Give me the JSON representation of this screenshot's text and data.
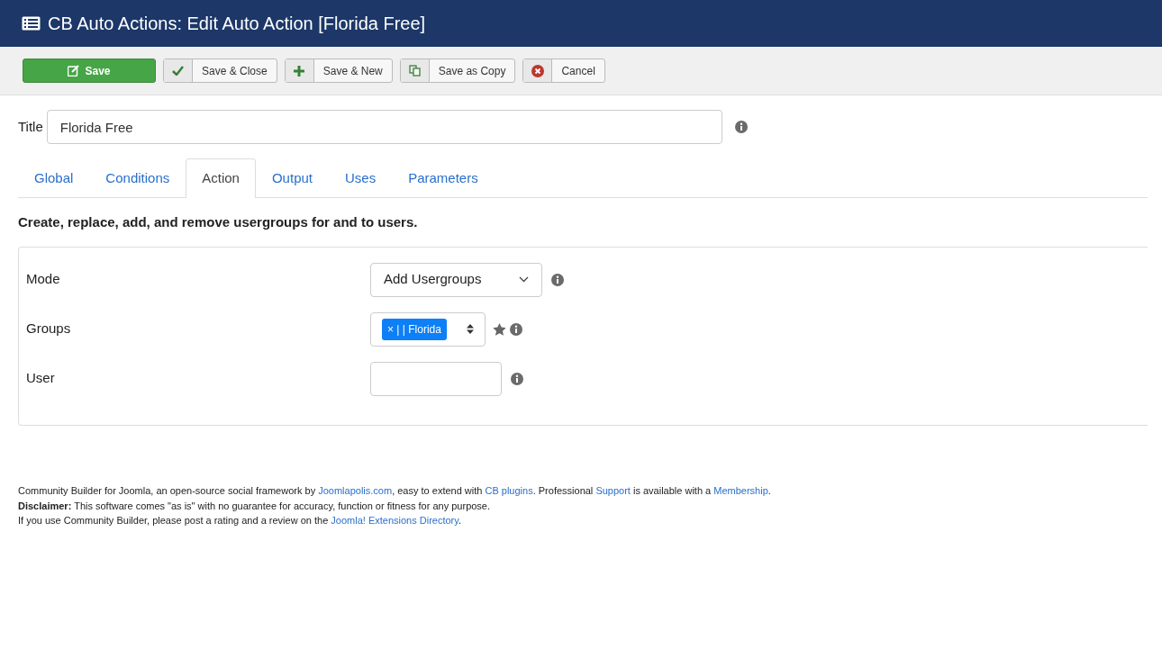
{
  "window": {
    "title": "CB Auto Actions: Edit Auto Action [Florida Free]"
  },
  "toolbar": [
    {
      "label": "Save",
      "kind": "primary"
    },
    {
      "label": "Save & Close",
      "kind": "check"
    },
    {
      "label": "Save & New",
      "kind": "plus"
    },
    {
      "label": "Save as Copy",
      "kind": "copy"
    },
    {
      "label": "Cancel",
      "kind": "cancel"
    }
  ],
  "title_field": {
    "label": "Title",
    "value": "Florida Free"
  },
  "tabs": [
    {
      "label": "Global",
      "selected": false
    },
    {
      "label": "Conditions",
      "selected": false
    },
    {
      "label": "Action",
      "selected": true
    },
    {
      "label": "Output",
      "selected": false
    },
    {
      "label": "Uses",
      "selected": false
    },
    {
      "label": "Parameters",
      "selected": false
    }
  ],
  "description": "Create, replace, add, and remove usergroups for and to users.",
  "fields": [
    {
      "label": "Mode",
      "kind": "select",
      "value": "Add Usergroups"
    },
    {
      "label": "Groups",
      "kind": "tags",
      "tags": [
        "× | | Florida"
      ]
    },
    {
      "label": "User",
      "kind": "text"
    }
  ],
  "footer": [
    [
      {
        "kind": "text",
        "text": "Community Builder for Joomla, an open-source social framework by "
      },
      {
        "kind": "link",
        "text": "Joomlapolis.com"
      },
      {
        "kind": "text",
        "text": ", easy to extend with "
      },
      {
        "kind": "link",
        "text": "CB plugins"
      },
      {
        "kind": "text",
        "text": ". Professional "
      },
      {
        "kind": "link",
        "text": "Support"
      },
      {
        "kind": "text",
        "text": " is available with a "
      },
      {
        "kind": "link",
        "text": "Membership"
      },
      {
        "kind": "text",
        "text": "."
      }
    ],
    [
      {
        "kind": "bold",
        "text": "Disclaimer:"
      },
      {
        "kind": "text",
        "text": " This software comes \"as is\" with no guarantee for accuracy, function or fitness for any purpose."
      }
    ],
    [
      {
        "kind": "text",
        "text": "If you use Community Builder, please post a rating and a review on the "
      },
      {
        "kind": "link",
        "text": "Joomla! Extensions Directory"
      },
      {
        "kind": "text",
        "text": "."
      }
    ]
  ]
}
